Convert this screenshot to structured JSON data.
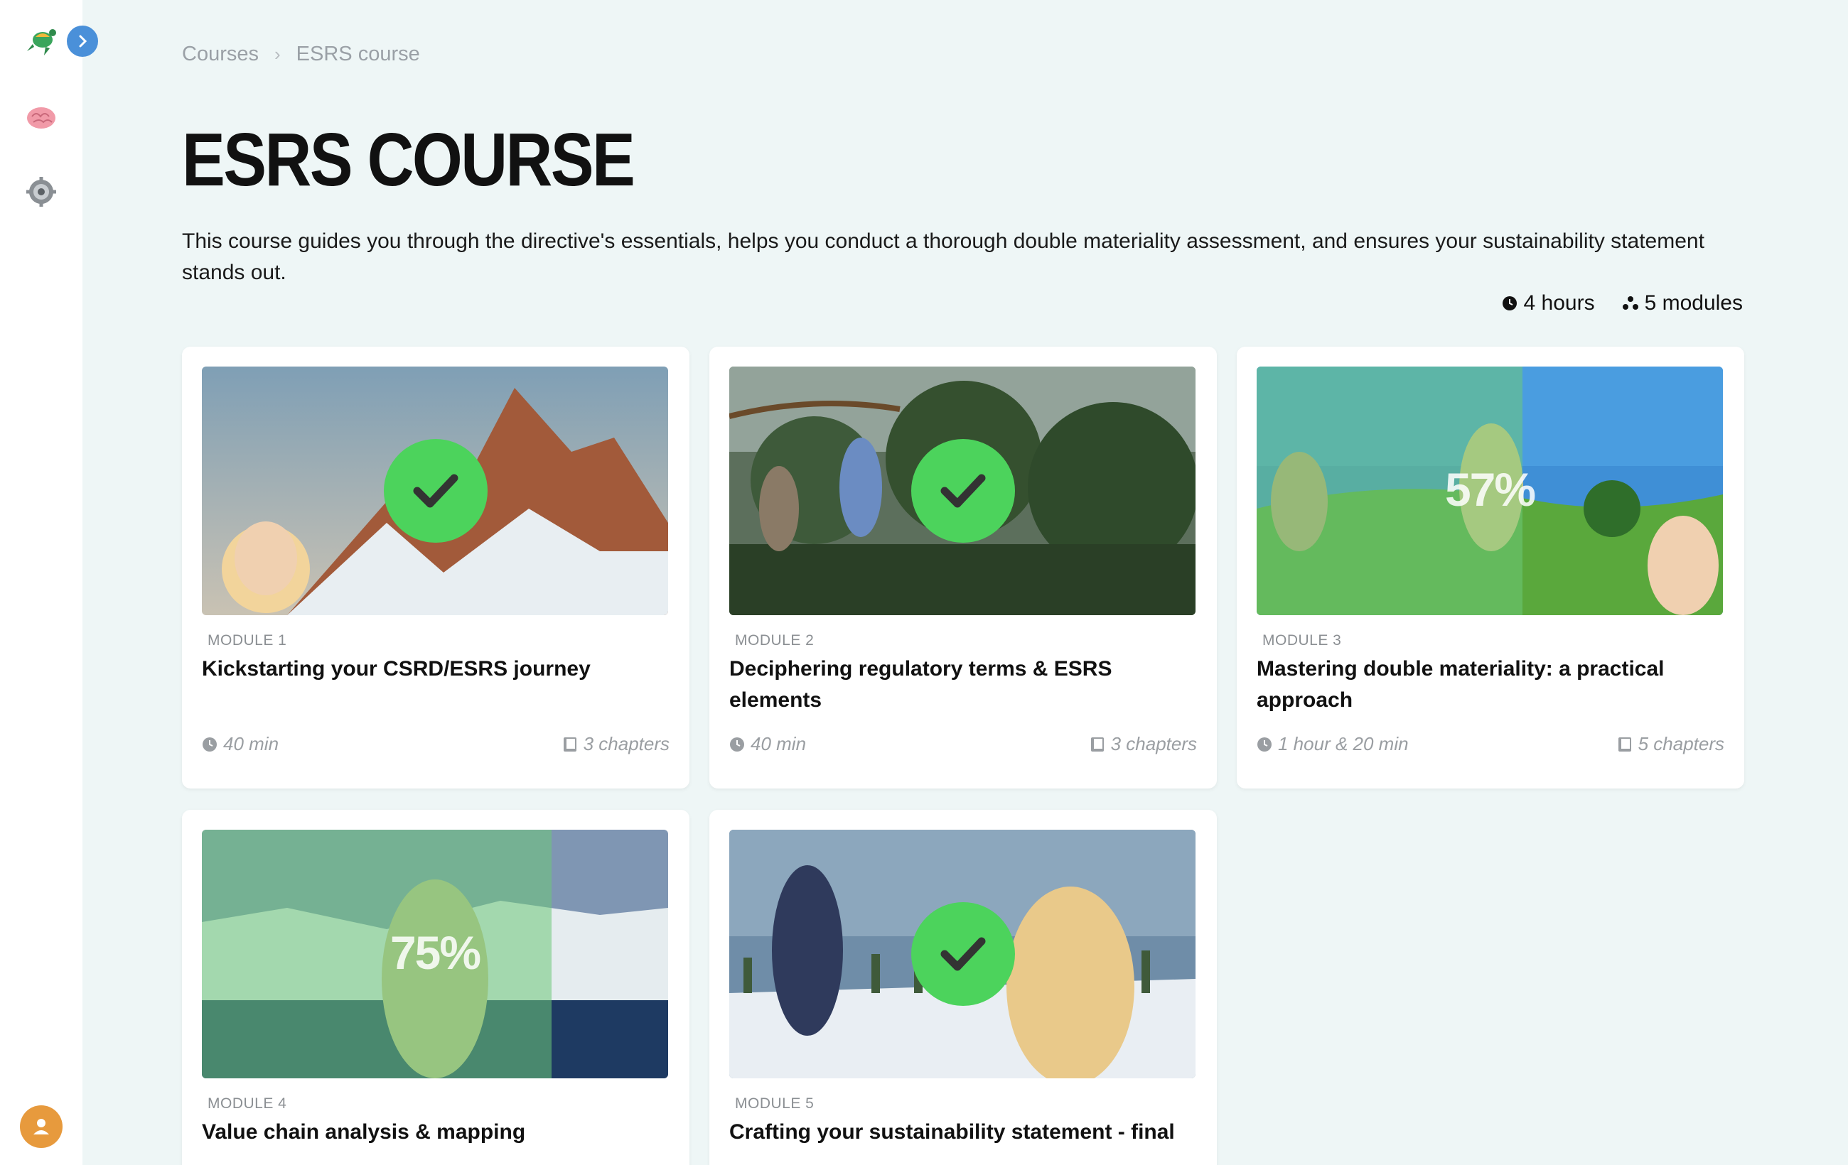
{
  "sidebar": {
    "items": [
      {
        "icon": "turtle-logo-icon"
      },
      {
        "icon": "brain-icon"
      },
      {
        "icon": "settings-gear-icon"
      }
    ],
    "expand_icon": "chevron-right-icon",
    "user_icon": "user-avatar-icon"
  },
  "breadcrumb": {
    "items": [
      "Courses",
      "ESRS course"
    ]
  },
  "course": {
    "title": "ESRS COURSE",
    "description": "This course guides you through the directive's essentials, helps you conduct a thorough double materiality assessment, and ensures your sustainability statement stands out.",
    "duration": "4 hours",
    "modules_count": "5 modules"
  },
  "modules": [
    {
      "label": "MODULE 1",
      "title": "Kickstarting your CSRD/ESRS journey",
      "duration": "40 min",
      "chapters": "3 chapters",
      "status": "completed",
      "progress": 1.0
    },
    {
      "label": "MODULE 2",
      "title": "Deciphering regulatory terms & ESRS elements",
      "duration": "40 min",
      "chapters": "3 chapters",
      "status": "completed",
      "progress": 1.0
    },
    {
      "label": "MODULE 3",
      "title": "Mastering double materiality: a practical approach",
      "duration": "1 hour & 20 min",
      "chapters": "5 chapters",
      "status": "in-progress",
      "progress": 0.57,
      "progress_text": "57%"
    },
    {
      "label": "MODULE 4",
      "title": "Value chain analysis & mapping",
      "duration": "",
      "chapters": "",
      "status": "in-progress",
      "progress": 0.75,
      "progress_text": "75%"
    },
    {
      "label": "MODULE 5",
      "title": "Crafting your sustainability statement - final",
      "duration": "",
      "chapters": "",
      "status": "completed",
      "progress": 1.0
    }
  ],
  "colors": {
    "accent_blue": "#4a90d9",
    "check_green": "#4cd35c",
    "avatar_orange": "#e79a3d",
    "background": "#eef6f6"
  }
}
